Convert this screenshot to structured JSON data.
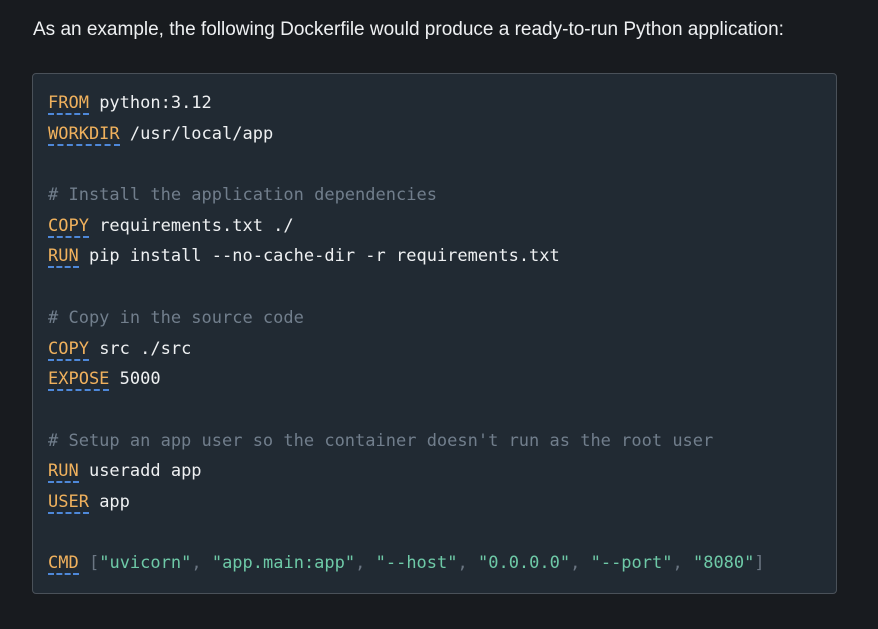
{
  "intro_text": "As an example, the following Dockerfile would produce a ready-to-run Python application:",
  "dockerfile": {
    "from_kw": "FROM",
    "from_val": " python:3.12",
    "workdir_kw": "WORKDIR",
    "workdir_val": " /usr/local/app",
    "comment_deps": "# Install the application dependencies",
    "copy1_kw": "COPY",
    "copy1_val": " requirements.txt ./",
    "run1_kw": "RUN",
    "run1_val": " pip install --no-cache-dir -r requirements.txt",
    "comment_src": "# Copy in the source code",
    "copy2_kw": "COPY",
    "copy2_val": " src ./src",
    "expose_kw": "EXPOSE",
    "expose_val": " 5000",
    "comment_user": "# Setup an app user so the container doesn't run as the root user",
    "run2_kw": "RUN",
    "run2_val": " useradd app",
    "user_kw": "USER",
    "user_val": " app",
    "cmd_kw": "CMD",
    "cmd_args": [
      "\"uvicorn\"",
      "\"app.main:app\"",
      "\"--host\"",
      "\"0.0.0.0\"",
      "\"--port\"",
      "\"8080\""
    ]
  },
  "colors": {
    "keyword": "#f0b15d",
    "comment": "#717e8c",
    "string": "#6ec9a7",
    "link_underline": "#4e88d9",
    "code_background": "#212a33",
    "page_background": "#181b1f"
  }
}
